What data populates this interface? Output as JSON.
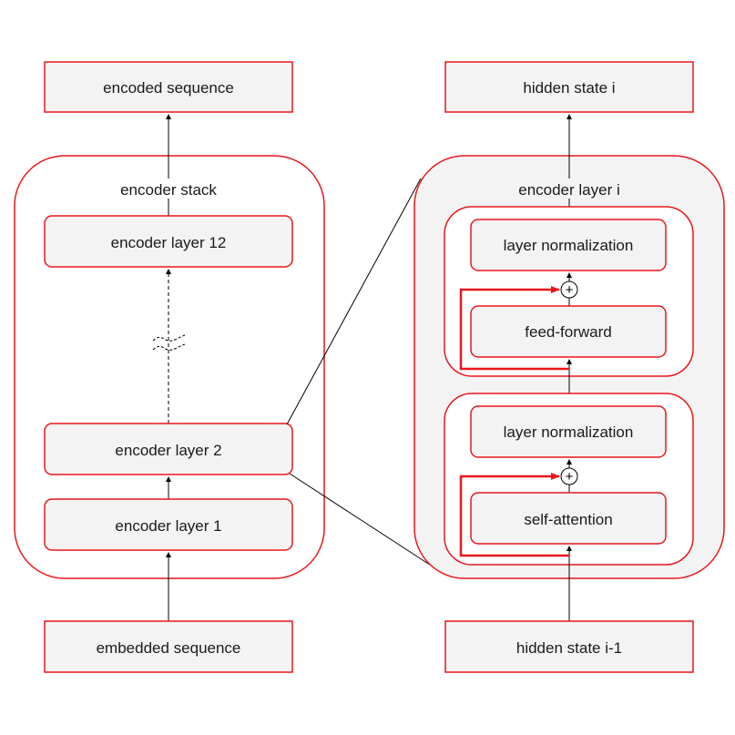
{
  "diagram": {
    "colors": {
      "border": "#e8171c",
      "box_fill": "#f3f3f3",
      "container_fill_right": "#f3f3f3",
      "arrow": "#000000",
      "residual": "#e8171c"
    },
    "left": {
      "output": "encoded sequence",
      "stack_title": "encoder stack",
      "layers": [
        "encoder layer 12",
        "encoder layer 2",
        "encoder layer 1"
      ],
      "input": "embedded sequence"
    },
    "right": {
      "output": "hidden state i",
      "layer_title": "encoder layer i",
      "upper_block": {
        "norm": "layer normalization",
        "sublayer": "feed-forward"
      },
      "lower_block": {
        "norm": "layer normalization",
        "sublayer": "self-attention"
      },
      "input": "hidden state i-1",
      "add_symbol": "+"
    }
  }
}
